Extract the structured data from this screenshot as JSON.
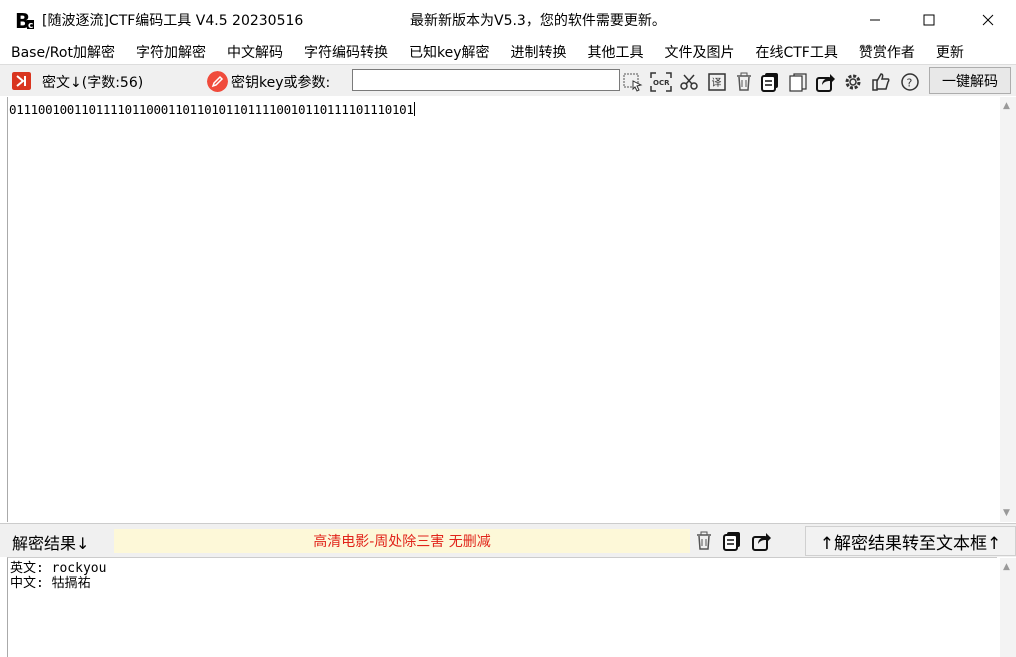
{
  "window": {
    "title": "[随波逐流]CTF编码工具 V4.5 20230516",
    "notice": "最新新版本为V5.3，您的软件需要更新。"
  },
  "menu": [
    "Base/Rot加解密",
    "字符加解密",
    "中文解码",
    "字符编码转换",
    "已知key解密",
    "进制转换",
    "其他工具",
    "文件及图片",
    "在线CTF工具",
    "赞赏作者",
    "更新"
  ],
  "toolbar": {
    "cipher_label": "密文↓(字数:56)",
    "key_label": "密钥key或参数:",
    "key_value": "",
    "one_click_decode": "一键解码",
    "icons": [
      "select-icon",
      "ocr-icon",
      "scissors-icon",
      "translate-icon",
      "trash-icon",
      "copy-icon",
      "paste-icon",
      "share-icon",
      "gear-icon",
      "thumbs-up-icon",
      "help-icon"
    ]
  },
  "cipher": {
    "text": "01110010011011110110001101101011011110010110111101110101"
  },
  "result_bar": {
    "label": "解密结果↓",
    "ad": "高清电影-周处除三害 无删减",
    "transfer_button": "↑解密结果转至文本框↑"
  },
  "result": {
    "line1": "英文: rockyou",
    "line2": "中文: 牯搹祐"
  },
  "colors": {
    "accent_red": "#e1251b",
    "toolbar_bg": "#f0f0f0",
    "ad_bg": "#fdf8d8"
  }
}
